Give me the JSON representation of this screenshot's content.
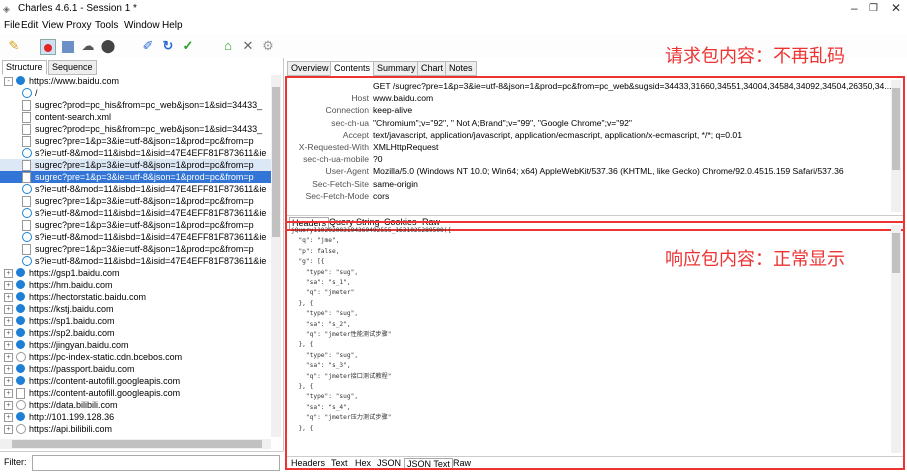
{
  "window": {
    "title": "Charles 4.6.1 - Session 1 *",
    "controls": [
      "minimize-icon",
      "maximize-icon",
      "close-icon"
    ]
  },
  "menu": [
    "File",
    "Edit",
    "View",
    "Proxy",
    "Tools",
    "Window",
    "Help"
  ],
  "toolbar": {
    "icons": [
      "broom-icon",
      "record-icon",
      "throttle-icon",
      "breakpoint-icon",
      "stop-icon",
      "pen-icon",
      "refresh-icon",
      "check-icon",
      "basket-icon",
      "tools-icon",
      "settings-icon"
    ]
  },
  "left": {
    "tabs": [
      "Structure",
      "Sequence"
    ],
    "tree": [
      {
        "label": "https://www.baidu.com",
        "level": 0,
        "icon": "globe",
        "expand": "-"
      },
      {
        "label": "/",
        "level": 1,
        "icon": "sub"
      },
      {
        "label": "sugrec?prod=pc_his&from=pc_web&json=1&sid=34433_",
        "level": 1,
        "icon": "doc"
      },
      {
        "label": "content-search.xml",
        "level": 1,
        "icon": "doc"
      },
      {
        "label": "sugrec?prod=pc_his&from=pc_web&json=1&sid=34433_",
        "level": 1,
        "icon": "doc"
      },
      {
        "label": "sugrec?pre=1&p=3&ie=utf-8&json=1&prod=pc&from=p",
        "level": 1,
        "icon": "doc"
      },
      {
        "label": "s?ie=utf-8&mod=11&isbd=1&isid=47E4EFF81F873611&ie",
        "level": 1,
        "icon": "sub"
      },
      {
        "label": "sugrec?pre=1&p=3&ie=utf-8&json=1&prod=pc&from=p",
        "level": 1,
        "icon": "doc",
        "state": "hl"
      },
      {
        "label": "sugrec?pre=1&p=3&ie=utf-8&json=1&prod=pc&from=p",
        "level": 1,
        "icon": "doc",
        "state": "sel"
      },
      {
        "label": "s?ie=utf-8&mod=11&isbd=1&isid=47E4EFF81F873611&ie",
        "level": 1,
        "icon": "sub"
      },
      {
        "label": "sugrec?pre=1&p=3&ie=utf-8&json=1&prod=pc&from=p",
        "level": 1,
        "icon": "doc"
      },
      {
        "label": "s?ie=utf-8&mod=11&isbd=1&isid=47E4EFF81F873611&ie",
        "level": 1,
        "icon": "sub"
      },
      {
        "label": "sugrec?pre=1&p=3&ie=utf-8&json=1&prod=pc&from=p",
        "level": 1,
        "icon": "doc"
      },
      {
        "label": "s?ie=utf-8&mod=11&isbd=1&isid=47E4EFF81F873611&ie",
        "level": 1,
        "icon": "sub"
      },
      {
        "label": "sugrec?pre=1&p=3&ie=utf-8&json=1&prod=pc&from=p",
        "level": 1,
        "icon": "doc"
      },
      {
        "label": "s?ie=utf-8&mod=11&isbd=1&isid=47E4EFF81F873611&ie",
        "level": 1,
        "icon": "sub"
      },
      {
        "label": "https://gsp1.baidu.com",
        "level": 0,
        "icon": "globe",
        "expand": "+"
      },
      {
        "label": "https://hm.baidu.com",
        "level": 0,
        "icon": "globe",
        "expand": "+"
      },
      {
        "label": "https://hectorstatic.baidu.com",
        "level": 0,
        "icon": "globe",
        "expand": "+"
      },
      {
        "label": "https://kstj.baidu.com",
        "level": 0,
        "icon": "globe",
        "expand": "+"
      },
      {
        "label": "https://sp1.baidu.com",
        "level": 0,
        "icon": "globe",
        "expand": "+"
      },
      {
        "label": "https://sp2.baidu.com",
        "level": 0,
        "icon": "globe",
        "expand": "+"
      },
      {
        "label": "https://jingyan.baidu.com",
        "level": 0,
        "icon": "globe",
        "expand": "+"
      },
      {
        "label": "https://pc-index-static.cdn.bcebos.com",
        "level": 0,
        "icon": "plain",
        "expand": "+"
      },
      {
        "label": "https://passport.baidu.com",
        "level": 0,
        "icon": "globe",
        "expand": "+"
      },
      {
        "label": "https://content-autofill.googleapis.com",
        "level": 0,
        "icon": "globe",
        "expand": "+"
      },
      {
        "label": "https://content-autofill.googleapis.com",
        "level": 0,
        "icon": "lock",
        "expand": "+"
      },
      {
        "label": "https://data.bilibili.com",
        "level": 0,
        "icon": "plain",
        "expand": "+"
      },
      {
        "label": "http://101.199.128.36",
        "level": 0,
        "icon": "globe",
        "expand": "+"
      },
      {
        "label": "https://api.bilibili.com",
        "level": 0,
        "icon": "plain",
        "expand": "+"
      }
    ],
    "filter_label": "Filter:"
  },
  "right": {
    "tabs": [
      "Overview",
      "Contents",
      "Summary",
      "Chart",
      "Notes"
    ],
    "request_headers": [
      {
        "key": "",
        "value": "GET /sugrec?pre=1&p=3&ie=utf-8&json=1&prod=pc&from=pc_web&sugsid=34433,31660,34551,34004,34584,34092,34504,26350,34..."
      },
      {
        "key": "Host",
        "value": "www.baidu.com"
      },
      {
        "key": "Connection",
        "value": "keep-alive"
      },
      {
        "key": "sec-ch-ua",
        "value": "\"Chromium\";v=\"92\", \" Not A;Brand\";v=\"99\", \"Google Chrome\";v=\"92\""
      },
      {
        "key": "Accept",
        "value": "text/javascript, application/javascript, application/ecmascript, application/x-ecmascript, */*; q=0.01"
      },
      {
        "key": "X-Requested-With",
        "value": "XMLHttpRequest"
      },
      {
        "key": "sec-ch-ua-mobile",
        "value": "?0"
      },
      {
        "key": "User-Agent",
        "value": "Mozilla/5.0 (Windows NT 10.0; Win64; x64) AppleWebKit/537.36 (KHTML, like Gecko) Chrome/92.0.4515.159 Safari/537.36"
      },
      {
        "key": "Sec-Fetch-Site",
        "value": "same-origin"
      },
      {
        "key": "Sec-Fetch-Mode",
        "value": "cors"
      }
    ],
    "request_subtabs": [
      "Headers",
      "Query String",
      "Cookies",
      "Raw"
    ],
    "response_lines": [
      "jQuery110202003194369492555_1631025289500({",
      "  \"q\": \"jme\",",
      "  \"p\": false,",
      "  \"g\": [{",
      "    \"type\": \"sug\",",
      "    \"sa\": \"s_1\",",
      "    \"q\": \"jmeter\"",
      "  }, {",
      "    \"type\": \"sug\",",
      "    \"sa\": \"s_2\",",
      "    \"q\": \"jmeter性能测试步骤\"",
      "  }, {",
      "    \"type\": \"sug\",",
      "    \"sa\": \"s_3\",",
      "    \"q\": \"jmeter接口测试教程\"",
      "  }, {",
      "    \"type\": \"sug\",",
      "    \"sa\": \"s_4\",",
      "    \"q\": \"jmeter压力测试步骤\"",
      "  }, {"
    ],
    "response_subtabs": [
      "Headers",
      "Text",
      "Hex",
      "JSON",
      "JSON Text",
      "Raw"
    ],
    "annotations": {
      "request": "请求包内容：不再乱码",
      "response": "响应包内容：正常显示"
    }
  },
  "colors": {
    "annotation": "#e33333",
    "selection": "#3375d6"
  }
}
